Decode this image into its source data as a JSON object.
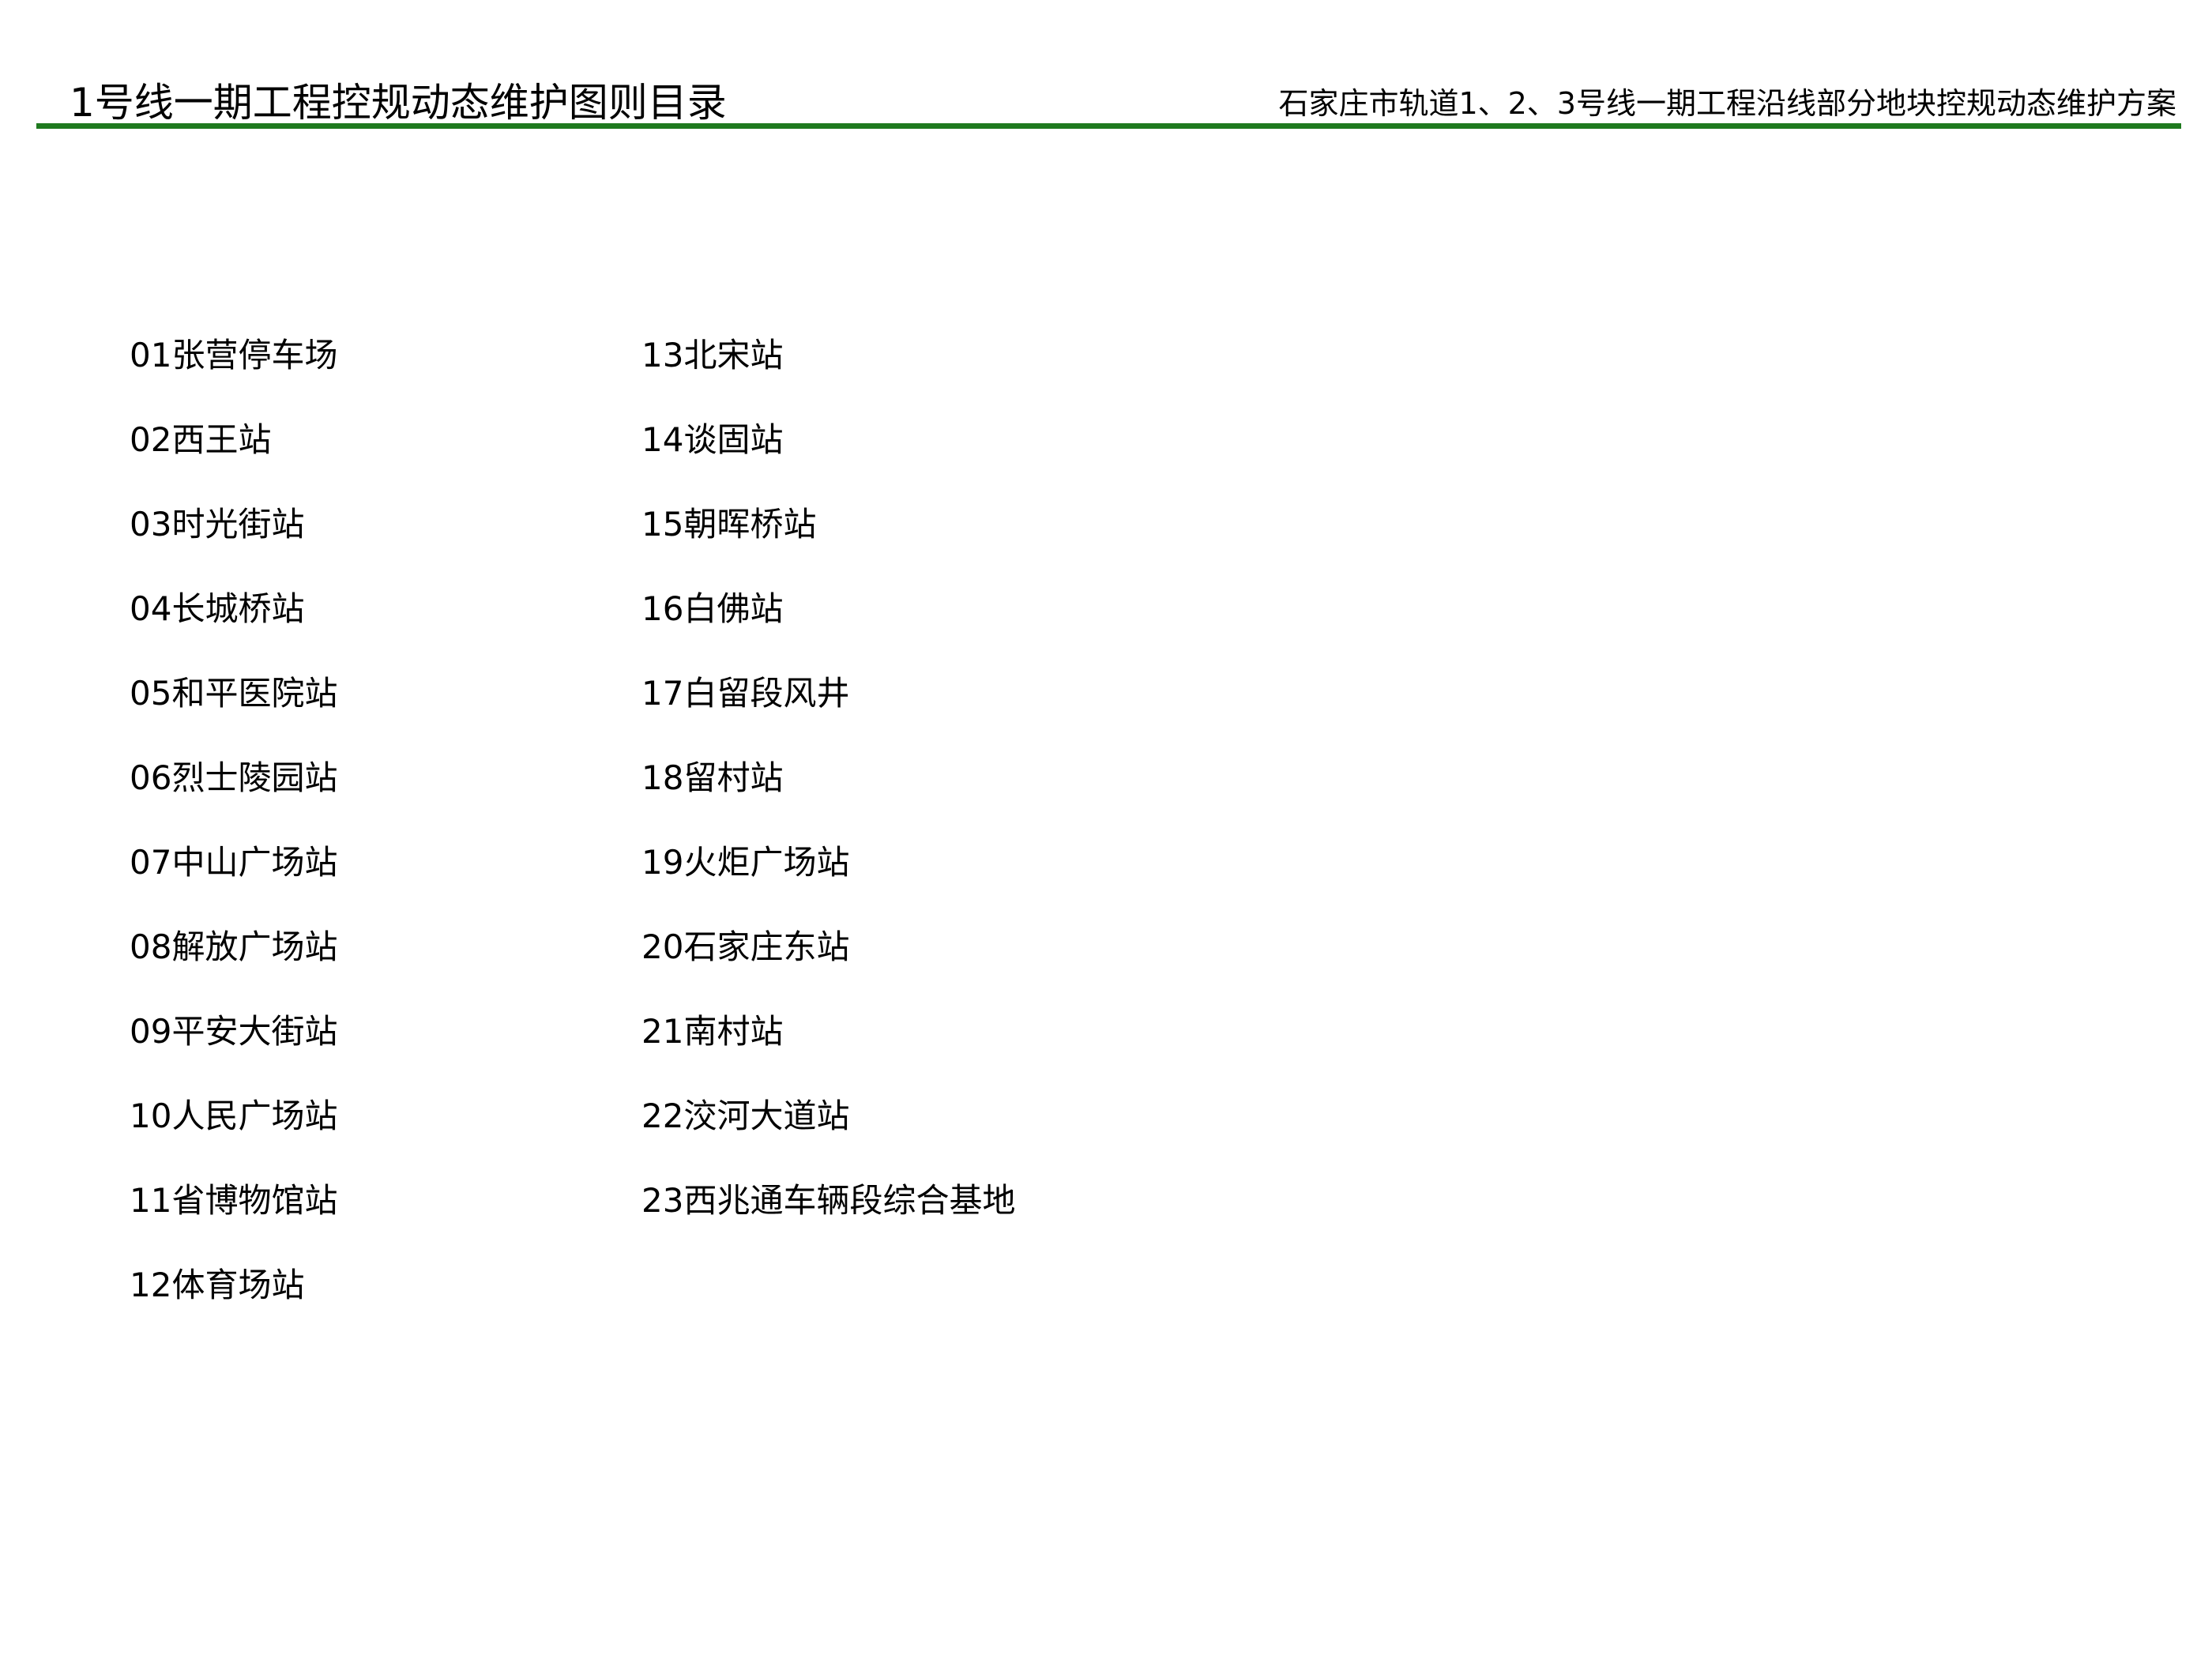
{
  "header": {
    "page_title": "1号线一期工程控规动态维护图则目录",
    "document_title": "石家庄市轨道1、2、3号线一期工程沿线部分地块控规动态维护方案",
    "rule_color": "#1f7a1f"
  },
  "toc": {
    "column_1": [
      "01张营停车场",
      "02西王站",
      "03时光街站",
      "04长城桥站",
      "05和平医院站",
      "06烈士陵园站",
      "07中山广场站",
      "08解放广场站",
      "09平安大街站",
      "10人民广场站",
      "11省博物馆站",
      "12体育场站"
    ],
    "column_2": [
      "13北宋站",
      "14谈固站",
      "15朝晖桥站",
      "16白佛站",
      "17白留段风井",
      "18留村站",
      "19火炬广场站",
      "20石家庄东站",
      "21南村站",
      "22洨河大道站",
      "23西兆通车辆段综合基地"
    ]
  }
}
